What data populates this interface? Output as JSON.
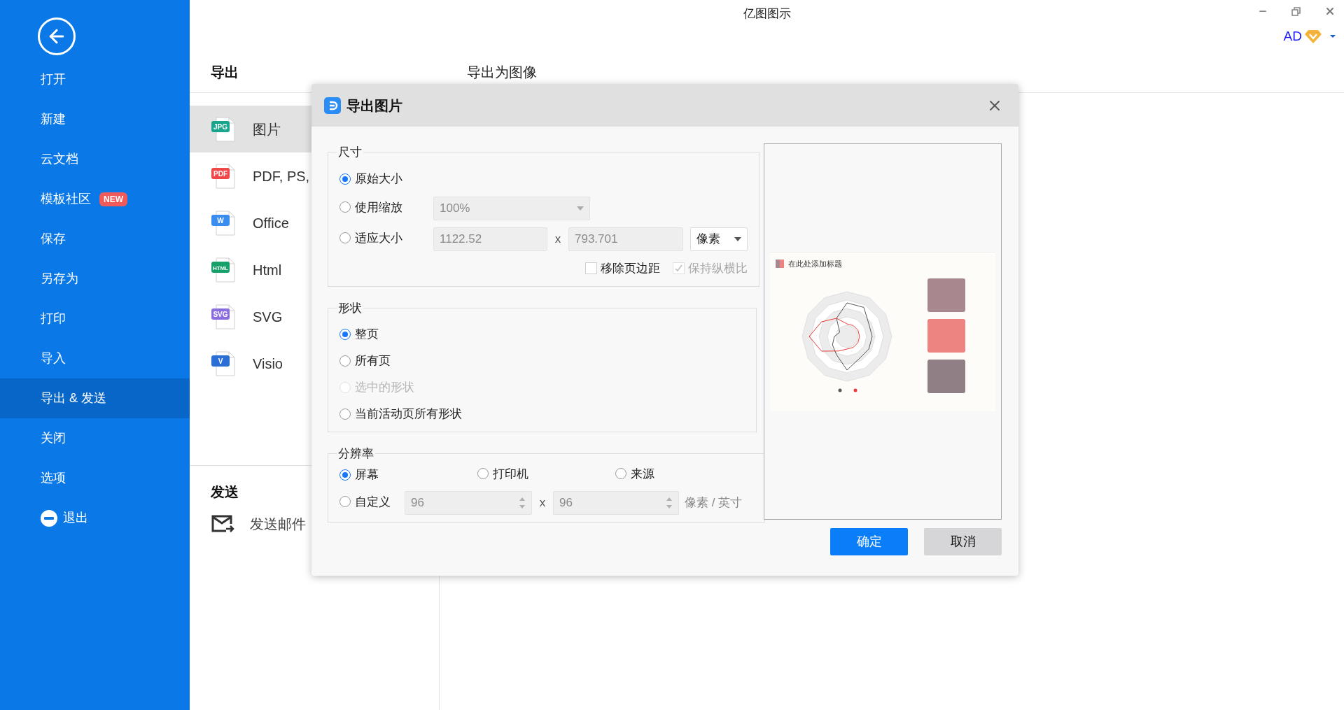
{
  "window": {
    "title": "亿图图示"
  },
  "account": {
    "label": "AD"
  },
  "sidebar": {
    "items": [
      {
        "label": "打开",
        "kind": "plain",
        "selected": false
      },
      {
        "label": "新建",
        "kind": "plain",
        "selected": false
      },
      {
        "label": "云文档",
        "kind": "plain",
        "selected": false
      },
      {
        "label": "模板社区",
        "kind": "plain",
        "selected": false,
        "badge": "NEW"
      },
      {
        "label": "保存",
        "kind": "plain",
        "selected": false
      },
      {
        "label": "另存为",
        "kind": "plain",
        "selected": false
      },
      {
        "label": "打印",
        "kind": "plain",
        "selected": false
      },
      {
        "label": "导入",
        "kind": "plain",
        "selected": false
      },
      {
        "label": "导出 & 发送",
        "kind": "plain",
        "selected": true
      },
      {
        "label": "关闭",
        "kind": "plain",
        "selected": false
      },
      {
        "label": "选项",
        "kind": "plain",
        "selected": false
      },
      {
        "label": "退出",
        "kind": "exit",
        "selected": false
      }
    ]
  },
  "export_panel": {
    "heading": "导出",
    "items": [
      {
        "label": "图片",
        "icon_text": "JPG",
        "color": "#18a58c",
        "selected": true
      },
      {
        "label": "PDF, PS,",
        "icon_text": "PDF",
        "color": "#f04848",
        "selected": false
      },
      {
        "label": "Office",
        "icon_text": "W",
        "color": "#3a8cf0",
        "selected": false
      },
      {
        "label": "Html",
        "icon_text": "HTML",
        "color": "#17a06a",
        "selected": false
      },
      {
        "label": "SVG",
        "icon_text": "SVG",
        "color": "#8a6ee0",
        "selected": false
      },
      {
        "label": "Visio",
        "icon_text": "V",
        "color": "#2b6fd6",
        "selected": false
      }
    ]
  },
  "send_panel": {
    "heading": "发送",
    "items": [
      {
        "label": "发送邮件"
      }
    ]
  },
  "content": {
    "title": "导出为图像"
  },
  "dialog": {
    "title": "导出图片",
    "size": {
      "legend": "尺寸",
      "options": [
        {
          "label": "原始大小",
          "selected": true,
          "disabled": false
        },
        {
          "label": "使用缩放",
          "selected": false,
          "disabled": false
        },
        {
          "label": "适应大小",
          "selected": false,
          "disabled": false
        }
      ],
      "scale": {
        "value": "100%",
        "disabled": true
      },
      "width": {
        "value": "1122.52",
        "disabled": true
      },
      "separator": "x",
      "height": {
        "value": "793.701",
        "disabled": true
      },
      "unit": {
        "value": "像素",
        "disabled": false
      },
      "checkboxes": [
        {
          "label": "移除页边距",
          "checked": false,
          "disabled": false
        },
        {
          "label": "保持纵横比",
          "checked": true,
          "disabled": true
        }
      ]
    },
    "shape": {
      "legend": "形状",
      "options": [
        {
          "label": "整页",
          "selected": true,
          "disabled": false
        },
        {
          "label": "所有页",
          "selected": false,
          "disabled": false
        },
        {
          "label": "选中的形状",
          "selected": false,
          "disabled": true
        },
        {
          "label": "当前活动页所有形状",
          "selected": false,
          "disabled": false
        }
      ]
    },
    "resolution": {
      "legend": "分辨率",
      "options": [
        {
          "label": "屏幕",
          "selected": true,
          "disabled": false
        },
        {
          "label": "打印机",
          "selected": false,
          "disabled": false
        },
        {
          "label": "来源",
          "selected": false,
          "disabled": false
        },
        {
          "label": "自定义",
          "selected": false,
          "disabled": false
        }
      ],
      "dpi_x": {
        "value": "96",
        "disabled": true
      },
      "separator": "x",
      "dpi_y": {
        "value": "96",
        "disabled": true
      },
      "unit": "像素 / 英寸"
    },
    "preview": {
      "title": "在此处添加标题"
    },
    "buttons": [
      {
        "label": "确定",
        "kind": "primary"
      },
      {
        "label": "取消",
        "kind": "secondary"
      }
    ]
  }
}
